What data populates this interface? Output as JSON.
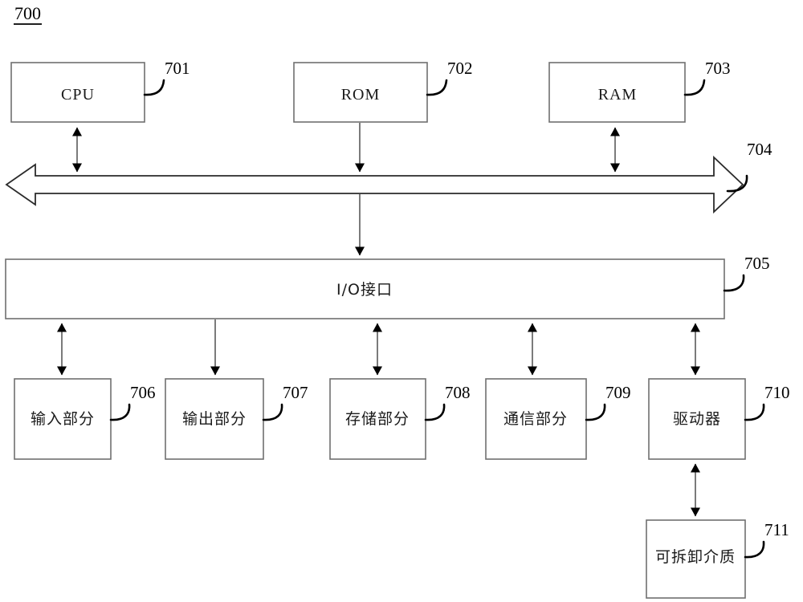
{
  "figure": {
    "number": "700",
    "type": "patent-block-diagram"
  },
  "nodes": [
    {
      "id": "cpu",
      "label": "CPU",
      "ref": "701",
      "script": "latin"
    },
    {
      "id": "rom",
      "label": "ROM",
      "ref": "702",
      "script": "latin"
    },
    {
      "id": "ram",
      "label": "RAM",
      "ref": "703",
      "script": "latin"
    },
    {
      "id": "bus",
      "label": "",
      "ref": "704",
      "script": "none"
    },
    {
      "id": "io",
      "label": "I/O接口",
      "ref": "705",
      "script": "cjk"
    },
    {
      "id": "input",
      "label": "输入部分",
      "ref": "706",
      "script": "cjk"
    },
    {
      "id": "output",
      "label": "输出部分",
      "ref": "707",
      "script": "cjk"
    },
    {
      "id": "storage",
      "label": "存储部分",
      "ref": "708",
      "script": "cjk"
    },
    {
      "id": "comm",
      "label": "通信部分",
      "ref": "709",
      "script": "cjk"
    },
    {
      "id": "driver",
      "label": "驱动器",
      "ref": "710",
      "script": "cjk"
    },
    {
      "id": "media",
      "label": "可拆卸介质",
      "ref": "711",
      "script": "cjk"
    }
  ],
  "labels": {
    "cpu": "CPU",
    "rom": "ROM",
    "ram": "RAM",
    "io": "I/O接口",
    "input": "输入部分",
    "output": "输出部分",
    "storage": "存储部分",
    "comm": "通信部分",
    "driver": "驱动器",
    "media": "可拆卸介质"
  },
  "refs": {
    "fig": "700",
    "cpu": "701",
    "rom": "702",
    "ram": "703",
    "bus": "704",
    "io": "705",
    "input": "706",
    "output": "707",
    "storage": "708",
    "comm": "709",
    "driver": "710",
    "media": "711"
  },
  "colors": {
    "background": "#ffffff",
    "box_stroke": "#6f6f6f",
    "connector": "#5a5a5a",
    "bus_stroke": "#2b2b2b",
    "text": "#1a1a1a",
    "leader": "#000000"
  }
}
